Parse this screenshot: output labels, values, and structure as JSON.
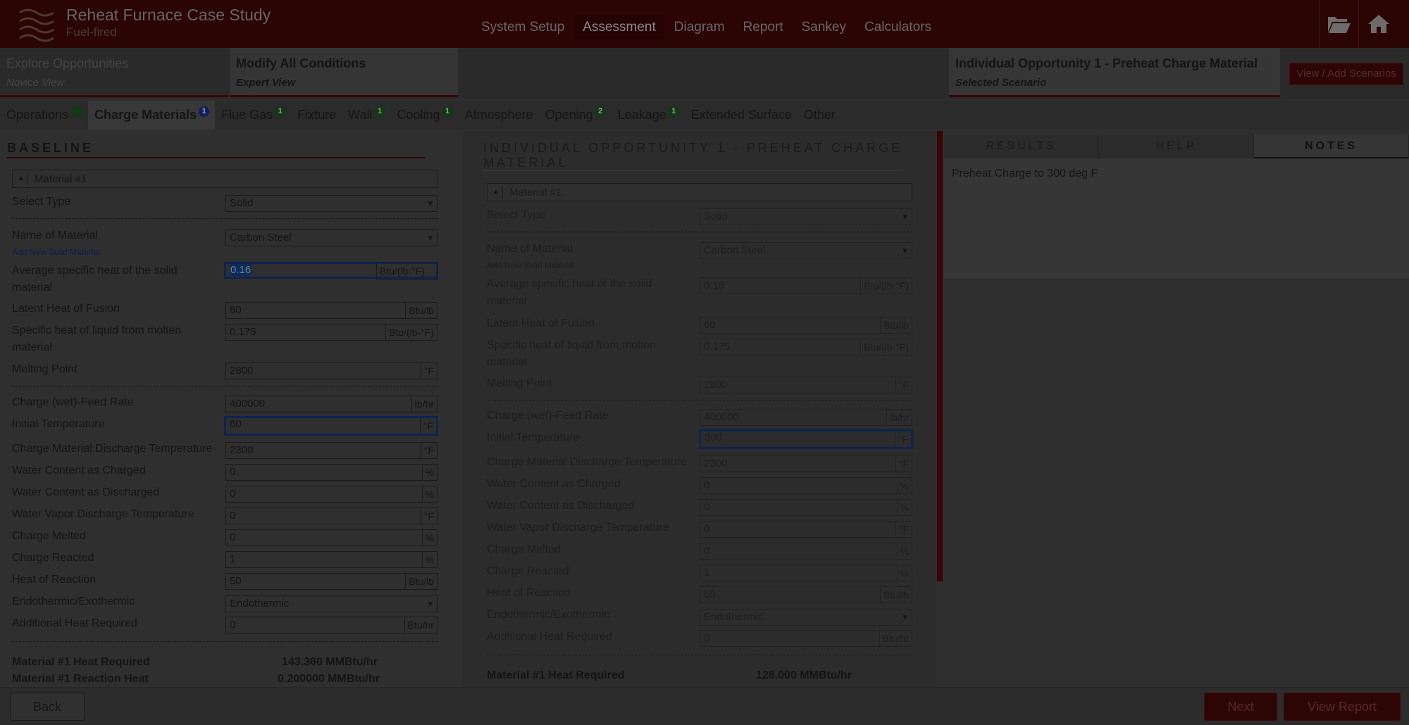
{
  "header": {
    "title": "Reheat Furnace Case Study",
    "subtitle": "Fuel-fired",
    "nav": [
      "System Setup",
      "Assessment",
      "Diagram",
      "Report",
      "Sankey",
      "Calculators"
    ],
    "active_nav": "Assessment",
    "icons": [
      "folder-open-icon",
      "home-icon"
    ]
  },
  "scenario_bar": {
    "explore": {
      "title": "Explore Opportunities",
      "sub": "Novice View"
    },
    "modify": {
      "title": "Modify All Conditions",
      "sub": "Expert View"
    },
    "selected": {
      "title": "Individual Opportunity 1 - Preheat Charge Material",
      "sub": "Selected Scenario"
    },
    "view_add_button": "View / Add Scenarios"
  },
  "tabs": [
    {
      "label": "Operations",
      "badge": "",
      "badge_color": "green"
    },
    {
      "label": "Charge Materials",
      "badge": "1",
      "badge_color": "blue"
    },
    {
      "label": "Flue Gas",
      "badge": "1",
      "badge_color": "green"
    },
    {
      "label": "Fixture",
      "badge": "",
      "badge_color": ""
    },
    {
      "label": "Wall",
      "badge": "1",
      "badge_color": "green"
    },
    {
      "label": "Cooling",
      "badge": "1",
      "badge_color": "green"
    },
    {
      "label": "Atmosphere",
      "badge": "",
      "badge_color": ""
    },
    {
      "label": "Opening",
      "badge": "2",
      "badge_color": "green"
    },
    {
      "label": "Leakage",
      "badge": "1",
      "badge_color": "green"
    },
    {
      "label": "Extended Surface",
      "badge": "",
      "badge_color": ""
    },
    {
      "label": "Other",
      "badge": "",
      "badge_color": ""
    }
  ],
  "labels": {
    "material_header": "Material #1",
    "select_type": "Select Type",
    "name_of_material": "Name of Material",
    "add_new_solid_material": "Add New Solid Material",
    "avg_specific_heat": "Average specific heat of the solid material",
    "latent_heat_fusion": "Latent Heat of Fusion",
    "specific_heat_liquid": "Specific heat of liquid from molten material",
    "melting_point": "Melting Point",
    "feed_rate": "Charge (wet)-Feed Rate",
    "initial_temp": "Initial Temperature",
    "discharge_temp": "Charge Material Discharge Temperature",
    "water_charged": "Water Content as Charged",
    "water_discharged": "Water Content as Discharged",
    "vapor_discharge_temp": "Water Vapor Discharge Temperature",
    "charge_melted": "Charge Melted",
    "charge_reacted": "Charge Reacted",
    "heat_of_reaction": "Heat of Reaction",
    "endo_exo": "Endothermic/Exothermic",
    "additional_heat": "Additional Heat Required",
    "heat_required_result": "Material #1 Heat Required",
    "reaction_heat_result": "Material #1 Reaction Heat"
  },
  "units": {
    "specific_heat": "Btu/(lb-°F)",
    "btu_lb": "Btu/lb",
    "deg_f": "°F",
    "lb_hr": "lb/hr",
    "percent": "%",
    "btu_hr": "Btu/hr"
  },
  "baseline": {
    "title": "BASELINE",
    "type": "Solid",
    "material": "Carbon Steel",
    "avg_specific_heat": "0.16",
    "latent_heat": "60",
    "specific_heat_liquid": "0.175",
    "melting_point": "2800",
    "feed_rate": "400000",
    "initial_temp": "60",
    "discharge_temp": "2300",
    "water_charged": "0",
    "water_discharged": "0",
    "vapor_temp": "0",
    "charge_melted": "0",
    "charge_reacted": "1",
    "heat_of_reaction": "50",
    "endo_exo": "Endothermic",
    "additional_heat": "0",
    "heat_required": "143.360 MMBtu/hr",
    "reaction_heat": "0.200000 MMBtu/hr"
  },
  "modification": {
    "title": "INDIVIDUAL OPPORTUNITY 1 - PREHEAT CHARGE MATERIAL",
    "type": "Solid",
    "material": "Carbon Steel",
    "avg_specific_heat": "0.16",
    "latent_heat": "60",
    "specific_heat_liquid": "0.175",
    "melting_point": "2800",
    "feed_rate": "400000",
    "initial_temp": "300",
    "discharge_temp": "2300",
    "water_charged": "0",
    "water_discharged": "0",
    "vapor_temp": "0",
    "charge_melted": "0",
    "charge_reacted": "1",
    "heat_of_reaction": "50",
    "endo_exo": "Endothermic",
    "additional_heat": "0",
    "heat_required": "128.000 MMBtu/hr"
  },
  "right_panel": {
    "tabs": [
      "RESULTS",
      "HELP",
      "NOTES"
    ],
    "active_tab": "NOTES",
    "notes_text": "Preheat Charge to 300 deg F"
  },
  "footer": {
    "back": "Back",
    "next": "Next",
    "view_report": "View Report"
  }
}
